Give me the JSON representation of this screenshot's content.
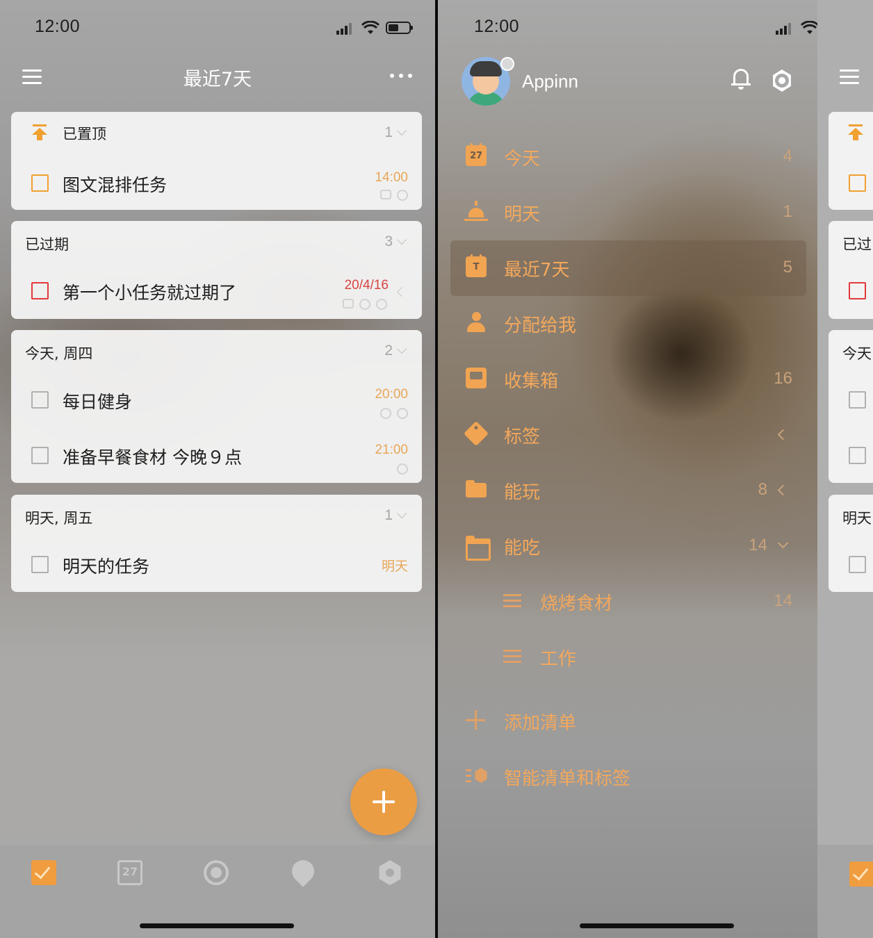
{
  "left": {
    "status": {
      "time": "12:00"
    },
    "header": {
      "title": "最近7天",
      "menu_icon": "hamburger-icon",
      "more_icon": "more-dots-icon"
    },
    "sections": [
      {
        "title": "已置顶",
        "count": "1",
        "icon": "pin-top-icon",
        "tasks": [
          {
            "title": "图文混排任务",
            "time": "14:00",
            "checkbox": "orange"
          }
        ]
      },
      {
        "title": "已过期",
        "count": "3",
        "tasks": [
          {
            "title": "第一个小任务就过期了",
            "time": "20/4/16",
            "checkbox": "red"
          }
        ]
      },
      {
        "title": "今天, 周四",
        "count": "2",
        "tasks": [
          {
            "title": "每日健身",
            "time": "20:00",
            "checkbox": "gray"
          },
          {
            "title": "准备早餐食材 今晚９点",
            "time": "21:00",
            "checkbox": "gray"
          }
        ]
      },
      {
        "title": "明天, 周五",
        "count": "1",
        "tasks": [
          {
            "title": "明天的任务",
            "time": "明天",
            "checkbox": "gray"
          }
        ]
      }
    ],
    "tabbar": {
      "calendar_day": "27",
      "tabs": [
        "checklist-tab-icon",
        "calendar-tab-icon",
        "pomodoro-tab-icon",
        "habit-clock-tab-icon",
        "settings-tab-icon"
      ]
    },
    "colors": {
      "accent": "#eb9d44",
      "overdue": "#d84343"
    }
  },
  "right": {
    "status": {
      "time": "12:00"
    },
    "profile": {
      "username": "Appinn"
    },
    "nav": [
      {
        "label": "今天",
        "count": "4",
        "icon": "calendar-today-icon",
        "icon_text": "27"
      },
      {
        "label": "明天",
        "count": "1",
        "icon": "sunrise-icon"
      },
      {
        "label": "最近7天",
        "count": "5",
        "icon": "calendar-week-icon",
        "icon_text": "T",
        "active": true
      },
      {
        "label": "分配给我",
        "count": "",
        "icon": "person-icon"
      },
      {
        "label": "收集箱",
        "count": "16",
        "icon": "inbox-icon"
      },
      {
        "label": "标签",
        "count": "",
        "icon": "tag-icon"
      },
      {
        "label": "能玩",
        "count": "8",
        "icon": "folder-icon"
      },
      {
        "label": "能吃",
        "count": "14",
        "icon": "folder-open-icon"
      },
      {
        "label": "烧烤食材",
        "count": "14",
        "icon": "list-icon"
      },
      {
        "label": "工作",
        "count": "",
        "icon": "list-icon"
      },
      {
        "label": "添加清单",
        "count": "",
        "icon": "plus-icon"
      },
      {
        "label": "智能清单和标签",
        "count": "",
        "icon": "smart-list-settings-icon"
      }
    ],
    "peek": {
      "section1": "已过",
      "section2": "今天",
      "section3": "明天"
    }
  }
}
